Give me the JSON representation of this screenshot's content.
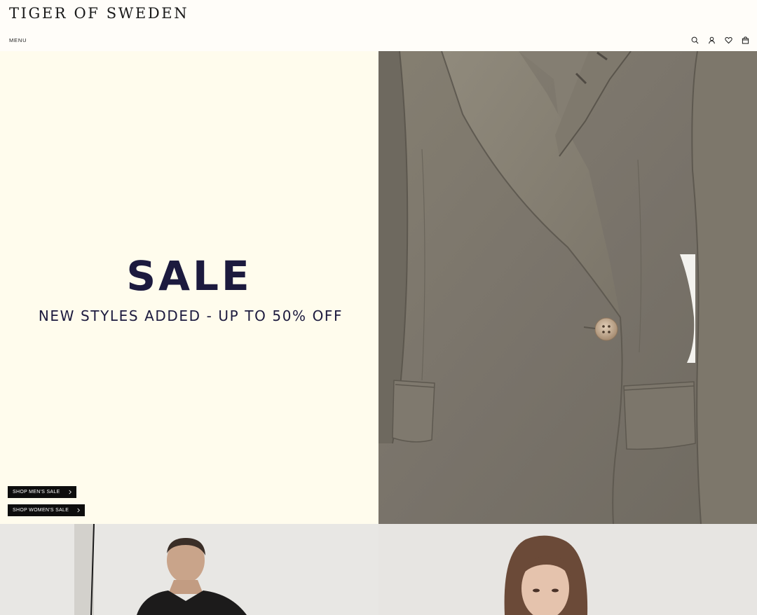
{
  "header": {
    "logo": "TIGER OF SWEDEN",
    "menu_label": "MENU",
    "icons": [
      "search-icon",
      "account-icon",
      "wishlist-icon",
      "bag-icon"
    ]
  },
  "hero": {
    "title": "SALE",
    "subtitle": "NEW STYLES ADDED - UP TO 50% OFF",
    "cta_men": "SHOP MEN'S SALE",
    "cta_women": "SHOP WOMEN'S SALE"
  },
  "colors": {
    "background": "#fffdf9",
    "hero_panel": "#fffced",
    "headline": "#1c1a3e",
    "button": "#0d0d0d"
  }
}
